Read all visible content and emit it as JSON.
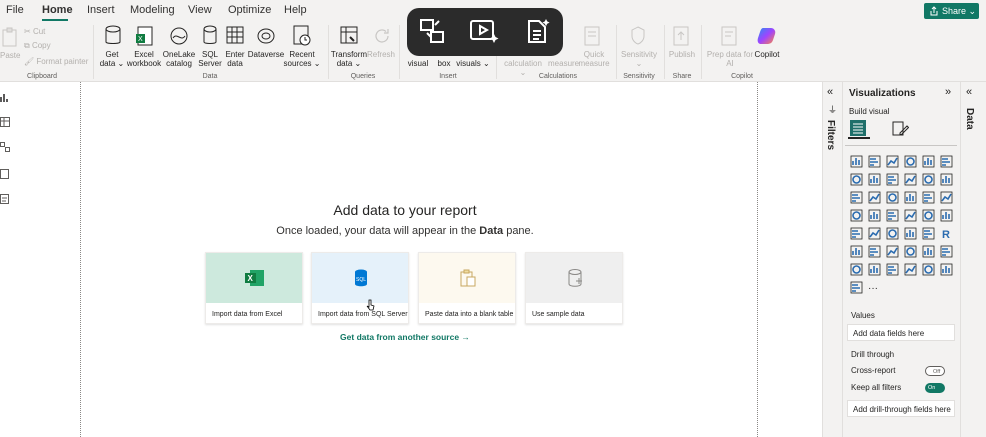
{
  "menu": [
    "File",
    "Home",
    "Insert",
    "Modeling",
    "View",
    "Optimize",
    "Help"
  ],
  "share_label": "Share",
  "ribbon": {
    "clipboard": {
      "paste": "Paste",
      "cut": "Cut",
      "copy": "Copy",
      "format_painter": "Format painter",
      "group": "Clipboard"
    },
    "data": {
      "get_data": "Get data",
      "excel": "Excel workbook",
      "onelake": "OneLake catalog",
      "sql": "SQL Server",
      "enter": "Enter data",
      "dataverse": "Dataverse",
      "recent": "Recent sources",
      "group": "Data"
    },
    "queries": {
      "transform": "Transform data",
      "refresh": "Refresh",
      "group": "Queries"
    },
    "insert": {
      "new_visual": "visual",
      "text_box": "box",
      "more_visuals": "visuals",
      "group": "Insert"
    },
    "calculations": {
      "calculation": "calculation",
      "new_measure": "measure",
      "quick_measure": "Quick measure",
      "group": "Calculations"
    },
    "sensitivity": {
      "label": "Sensitivity",
      "group": "Sensitivity"
    },
    "share": {
      "publish": "Publish",
      "group": "Share"
    },
    "copilot": {
      "prep": "Prep data for AI",
      "copilot": "Copilot",
      "group": "Copilot"
    }
  },
  "canvas": {
    "title": "Add data to your report",
    "subtitle_pre": "Once loaded, your data will appear in the ",
    "subtitle_bold": "Data",
    "subtitle_post": " pane.",
    "cards": [
      {
        "label": "Import data from Excel",
        "color": "#cde9dd"
      },
      {
        "label": "Import data from SQL Server",
        "color": "#e5f1fa"
      },
      {
        "label": "Paste data into a blank table",
        "color": "#fdf9ef"
      },
      {
        "label": "Use sample data",
        "color": "#efefef"
      }
    ],
    "get_data_link": "Get data from another source →"
  },
  "filters": {
    "label": "Filters"
  },
  "visualizations": {
    "title": "Visualizations",
    "build_visual": "Build visual",
    "values_label": "Values",
    "values_placeholder": "Add data fields here",
    "drill_through": "Drill through",
    "cross_report": "Cross-report",
    "cross_report_state": "Off",
    "keep_all_filters": "Keep all filters",
    "keep_all_filters_state": "On",
    "drill_placeholder": "Add drill-through fields here"
  },
  "data_pane": {
    "label": "Data"
  },
  "colors": {
    "accent": "#117865",
    "chrome": "#f3f2f1",
    "viz_blue": "#2b6cb0"
  }
}
